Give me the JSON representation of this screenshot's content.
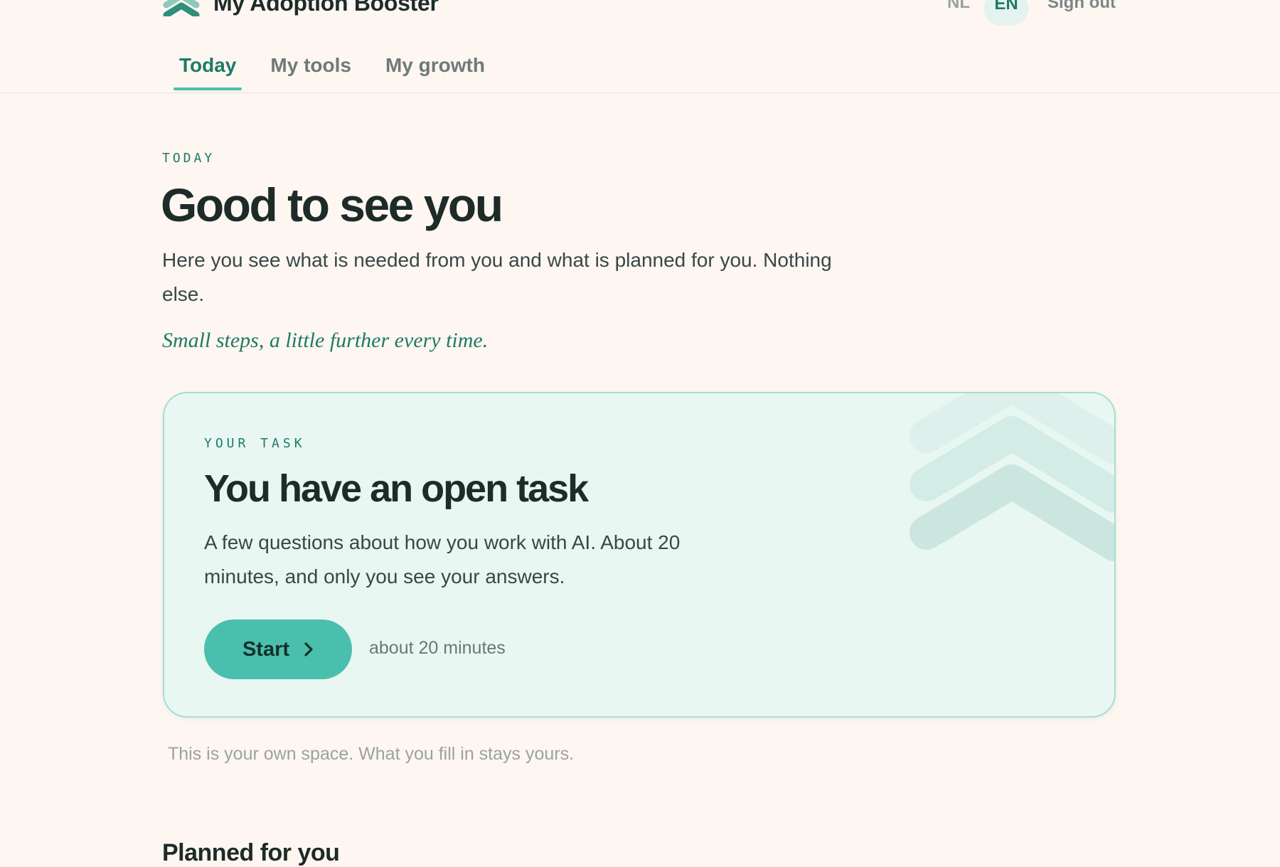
{
  "header": {
    "brand": "My Adoption Booster",
    "languages": [
      "NL",
      "EN"
    ],
    "active_language": "EN",
    "sign_out": "Sign out"
  },
  "tabs": [
    {
      "label": "Today",
      "active": true
    },
    {
      "label": "My tools",
      "active": false
    },
    {
      "label": "My growth",
      "active": false
    }
  ],
  "main": {
    "eyebrow": "TODAY",
    "title": "Good to see you",
    "intro": "Here you see what is needed from you and what is planned for you. Nothing else.",
    "motto": "Small steps, a little further every time."
  },
  "task_card": {
    "eyebrow": "YOUR TASK",
    "title": "You have an open task",
    "description": "A few questions about how you work with AI. About 20 minutes, and only you see your answers.",
    "button_label": "Start",
    "duration": "about 20 minutes"
  },
  "footnote": "This is your own space. What you fill in stays yours.",
  "next_section_title": "Planned for you",
  "colors": {
    "background": "#fdf6f1",
    "accent": "#1f7a66",
    "button": "#4bbfae",
    "card_bg": "#e9f7f3",
    "card_border": "#a6ddd2"
  },
  "icons": {
    "logo": "chevron-up-stack-icon",
    "button": "chevron-right-icon"
  }
}
